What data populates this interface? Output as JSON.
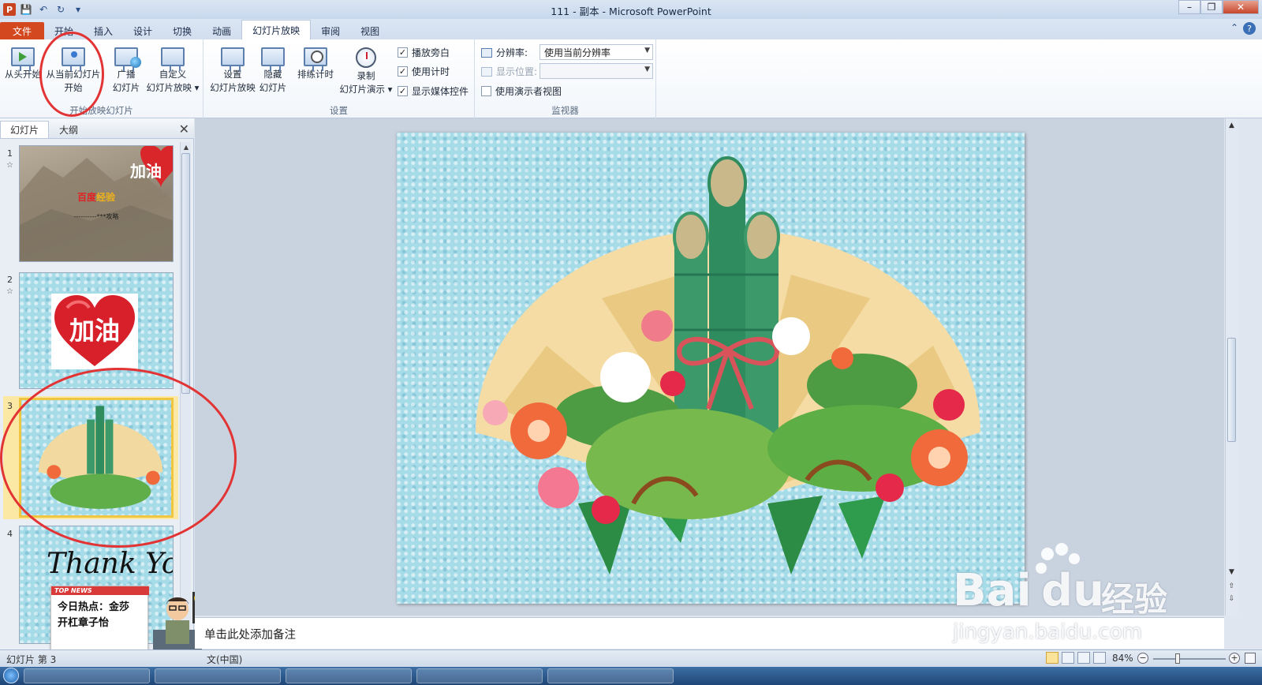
{
  "window": {
    "title": "111 - 副本 - Microsoft PowerPoint",
    "app_icon_letter": "P"
  },
  "tabs": {
    "file": "文件",
    "items": [
      {
        "label": "开始"
      },
      {
        "label": "插入"
      },
      {
        "label": "设计"
      },
      {
        "label": "切换"
      },
      {
        "label": "动画"
      },
      {
        "label": "幻灯片放映",
        "active": true
      },
      {
        "label": "审阅"
      },
      {
        "label": "视图"
      }
    ]
  },
  "ribbon": {
    "start_group": {
      "label": "开始放映幻灯片",
      "from_beginning": "从头开始",
      "from_current_line1": "从当前幻灯片",
      "from_current_line2": "开始",
      "broadcast_line1": "广播",
      "broadcast_line2": "幻灯片",
      "custom_line1": "自定义",
      "custom_line2": "幻灯片放映 ▾"
    },
    "setup_group": {
      "label": "设置",
      "setup_line1": "设置",
      "setup_line2": "幻灯片放映",
      "hide_line1": "隐藏",
      "hide_line2": "幻灯片",
      "rehearse": "排练计时",
      "record_line1": "录制",
      "record_line2": "幻灯片演示 ▾",
      "play_narrations": "播放旁白",
      "use_timings": "使用计时",
      "show_media_controls": "显示媒体控件"
    },
    "monitors_group": {
      "label": "监视器",
      "resolution_label": "分辨率:",
      "resolution_value": "使用当前分辨率",
      "show_on_label": "显示位置:",
      "show_on_value": "",
      "presenter_view": "使用演示者视图"
    }
  },
  "left_panel": {
    "tab_slides": "幻灯片",
    "tab_outline": "大纲",
    "slides": [
      {
        "number": "1",
        "heart_text": "加油",
        "title_red": "百度",
        "title_yellow": "经验",
        "subtitle": "----------***攻略"
      },
      {
        "number": "2",
        "heart_text": "加油"
      },
      {
        "number": "3"
      },
      {
        "number": "4",
        "script_text": "Thank You"
      }
    ]
  },
  "news_widget": {
    "tag": "TOP NEWS",
    "line1": "今日热点：金莎",
    "line2": "开杠章子怡"
  },
  "notes": {
    "placeholder": "单击此处添加备注"
  },
  "statusbar": {
    "slide_info": "幻灯片 第 3",
    "language": "文(中国)",
    "zoom": "84%"
  },
  "watermark": {
    "brand": "Bai",
    "brand_du": "du",
    "brand_cn": "经验",
    "url": "jingyan.baidu.com"
  },
  "colors": {
    "file_tab": "#d3481f",
    "annotation_red": "#e23434",
    "selected_border": "#f0c540",
    "slide_water": "#a6dbe8"
  }
}
